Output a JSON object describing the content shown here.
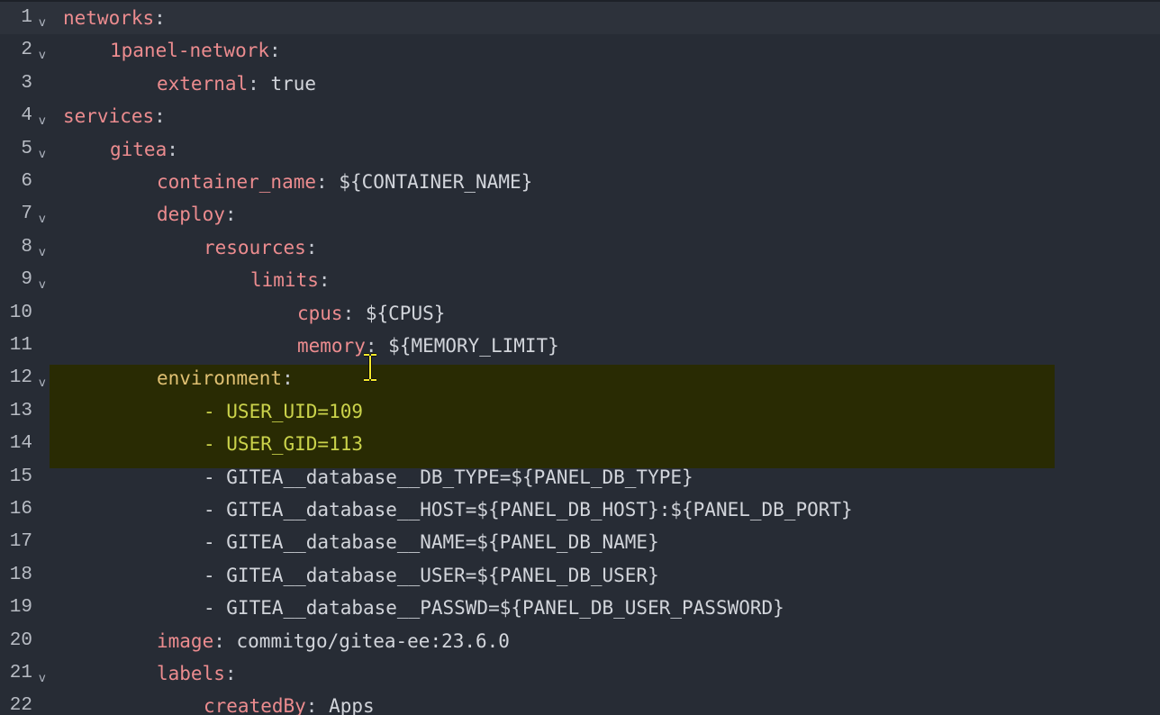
{
  "editor": {
    "language": "yaml",
    "theme": {
      "background": "#272c35",
      "key_color": "#ec8c8f",
      "value_color": "#d2d5db",
      "highlight_background": "#292b03",
      "highlight_key_color": "#e0c072",
      "highlight_value_color": "#cbd34b"
    },
    "highlighted_lines": [
      12,
      13,
      14
    ],
    "mouse_cursor_icon": "text-cursor-icon",
    "fold_marker_icon": "chevron-down-icon",
    "lines": [
      {
        "num": "1",
        "indent": 0,
        "key": "networks",
        "value": "",
        "fold": true
      },
      {
        "num": "2",
        "indent": 4,
        "key": "1panel-network",
        "value": "",
        "fold": true
      },
      {
        "num": "3",
        "indent": 8,
        "key": "external",
        "value": "true",
        "fold": false
      },
      {
        "num": "4",
        "indent": 0,
        "key": "services",
        "value": "",
        "fold": true
      },
      {
        "num": "5",
        "indent": 4,
        "key": "gitea",
        "value": "",
        "fold": true
      },
      {
        "num": "6",
        "indent": 8,
        "key": "container_name",
        "value": "${CONTAINER_NAME}",
        "fold": false
      },
      {
        "num": "7",
        "indent": 8,
        "key": "deploy",
        "value": "",
        "fold": true
      },
      {
        "num": "8",
        "indent": 12,
        "key": "resources",
        "value": "",
        "fold": true
      },
      {
        "num": "9",
        "indent": 16,
        "key": "limits",
        "value": "",
        "fold": true
      },
      {
        "num": "10",
        "indent": 20,
        "key": "cpus",
        "value": "${CPUS}",
        "fold": false
      },
      {
        "num": "11",
        "indent": 20,
        "key": "memory",
        "value": "${MEMORY_LIMIT}",
        "fold": false
      },
      {
        "num": "12",
        "indent": 8,
        "key": "environment",
        "value": "",
        "fold": true
      },
      {
        "num": "13",
        "indent": 12,
        "item": "- USER_UID=109",
        "fold": false
      },
      {
        "num": "14",
        "indent": 12,
        "item": "- USER_GID=113",
        "fold": false
      },
      {
        "num": "15",
        "indent": 12,
        "item": "- GITEA__database__DB_TYPE=${PANEL_DB_TYPE}",
        "fold": false
      },
      {
        "num": "16",
        "indent": 12,
        "item": "- GITEA__database__HOST=${PANEL_DB_HOST}:${PANEL_DB_PORT}",
        "fold": false
      },
      {
        "num": "17",
        "indent": 12,
        "item": "- GITEA__database__NAME=${PANEL_DB_NAME}",
        "fold": false
      },
      {
        "num": "18",
        "indent": 12,
        "item": "- GITEA__database__USER=${PANEL_DB_USER}",
        "fold": false
      },
      {
        "num": "19",
        "indent": 12,
        "item": "- GITEA__database__PASSWD=${PANEL_DB_USER_PASSWORD}",
        "fold": false
      },
      {
        "num": "20",
        "indent": 8,
        "key": "image",
        "value": "commitgo/gitea-ee:23.6.0",
        "fold": false
      },
      {
        "num": "21",
        "indent": 8,
        "key": "labels",
        "value": "",
        "fold": true
      },
      {
        "num": "22",
        "indent": 12,
        "key": "createdBy",
        "value": "Apps",
        "fold": false
      }
    ]
  }
}
